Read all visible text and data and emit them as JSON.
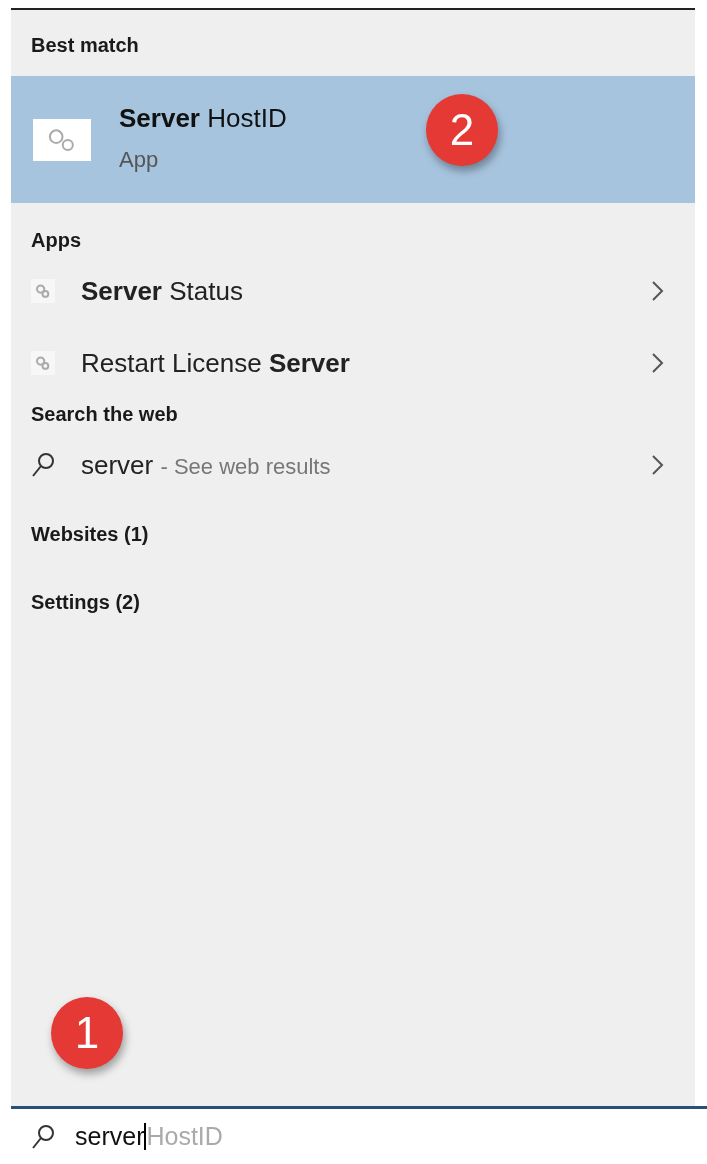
{
  "best_match": {
    "heading": "Best match",
    "title": "**Server** HostID",
    "subtitle": "App",
    "selected": true,
    "badge": "2"
  },
  "apps": {
    "heading": "Apps",
    "items": [
      {
        "label": "**Server** Status"
      },
      {
        "label": "Restart License **Server**"
      }
    ]
  },
  "web": {
    "heading": "Search the web",
    "query": "server",
    "hint": "- See web results"
  },
  "sections": [
    {
      "label": "Websites (1)"
    },
    {
      "label": "Settings (2)"
    }
  ],
  "search": {
    "value": "server",
    "suggestion": "HostID",
    "badge": "1"
  }
}
